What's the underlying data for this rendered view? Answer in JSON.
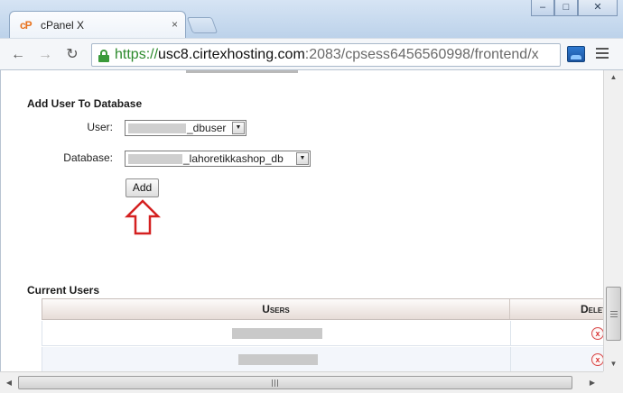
{
  "window": {
    "tab_title": "cPanel X",
    "favicon_text": "cP",
    "tab_close_glyph": "×",
    "controls": {
      "minimize": "–",
      "maximize": "□",
      "close": "✕"
    }
  },
  "toolbar": {
    "back_glyph": "←",
    "forward_glyph": "→",
    "reload_glyph": "↻",
    "url_scheme": "https://",
    "url_host": "usc8.cirtexhosting.com",
    "url_rest": ":2083/cpsess6456560998/frontend/x",
    "extension_icon": "screen-capture-icon",
    "menu_icon": "hamburger-menu-icon"
  },
  "add_user_section": {
    "title": "Add User To Database",
    "user_label": "User:",
    "user_value": "_dbuser",
    "database_label": "Database:",
    "database_value": "_lahoretikkashop_db",
    "dropdown_glyph": "▼",
    "add_button": "Add"
  },
  "current_users": {
    "title": "Current Users",
    "columns": [
      "Users",
      "Delete"
    ],
    "rows": [
      {
        "user": "",
        "delete_glyph": "x"
      },
      {
        "user": "",
        "delete_glyph": "x"
      }
    ]
  },
  "annotations": {
    "arrow_color": "#d42020"
  },
  "scrollbars": {
    "up_glyph": "▲",
    "down_glyph": "▼",
    "left_glyph": "◀",
    "right_glyph": "▶"
  }
}
